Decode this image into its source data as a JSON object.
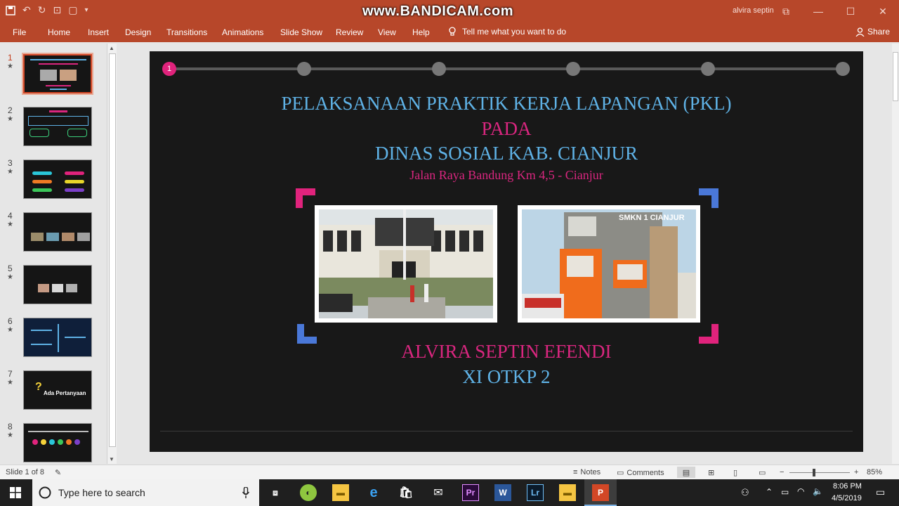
{
  "titlebar": {
    "watermark": "www.BANDICAM.com",
    "user": "alvira septin",
    "qat_icons": [
      "save-icon",
      "undo-icon",
      "redo-icon",
      "start-from-beginning-icon",
      "shape-icon",
      "customize-qat-icon"
    ]
  },
  "ribbon": {
    "tabs": [
      "File",
      "Home",
      "Insert",
      "Design",
      "Transitions",
      "Animations",
      "Slide Show",
      "Review",
      "View",
      "Help"
    ],
    "tell_me": "Tell me what you want to do",
    "share": "Share"
  },
  "thumbnails": [
    {
      "num": "1",
      "star": "★"
    },
    {
      "num": "2",
      "star": "★"
    },
    {
      "num": "3",
      "star": "★"
    },
    {
      "num": "4",
      "star": "★"
    },
    {
      "num": "5",
      "star": "★"
    },
    {
      "num": "6",
      "star": "★"
    },
    {
      "num": "7",
      "star": "★"
    },
    {
      "num": "8",
      "star": "★"
    }
  ],
  "thumb7_text": "Ada Pertanyaan",
  "slide": {
    "step_number": "1",
    "title_line1": "PELAKSANAAN PRAKTIK KERJA LAPANGAN (PKL)",
    "title_line2": "PADA",
    "title_line3": "DINAS SOSIAL KAB. CIANJUR",
    "address": "Jalan Raya Bandung Km 4,5 - Cianjur",
    "photo2_sign": "SMKN 1 CIANJUR",
    "author": "ALVIRA SEPTIN EFENDI",
    "class": "XI OTKP 2",
    "colors": {
      "blue": "#5fb2e6",
      "pink": "#d9267f",
      "bg": "#181818"
    }
  },
  "status": {
    "slide_info": "Slide 1 of 8",
    "notes": "Notes",
    "comments": "Comments",
    "zoom": "85%"
  },
  "taskbar": {
    "search_placeholder": "Type here to search",
    "time": "8:06 PM",
    "date": "4/5/2019",
    "apps": [
      "Pr",
      "W",
      "Lr",
      "P"
    ]
  }
}
